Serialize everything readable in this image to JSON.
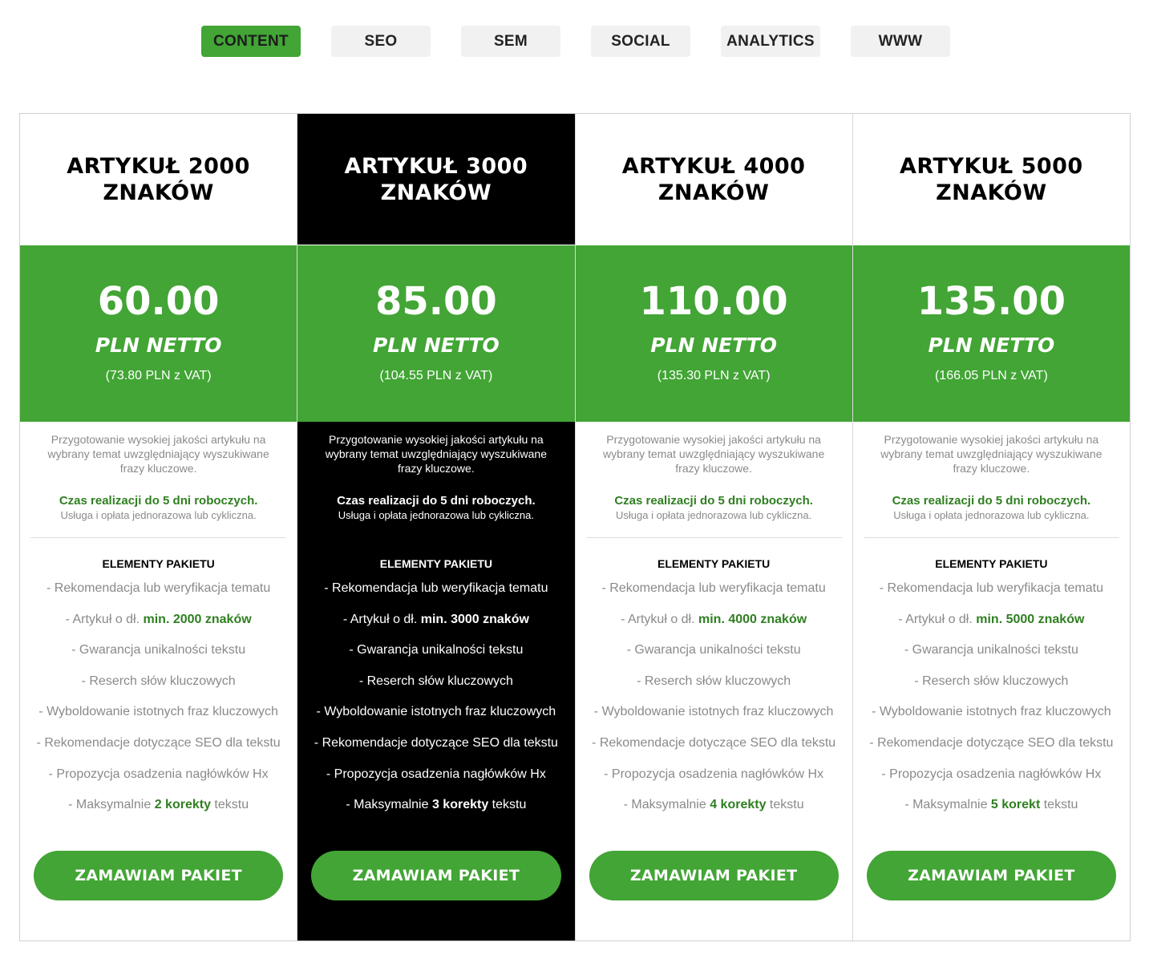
{
  "tabs": [
    {
      "label": "CONTENT",
      "active": true
    },
    {
      "label": "SEO",
      "active": false
    },
    {
      "label": "SEM",
      "active": false
    },
    {
      "label": "SOCIAL",
      "active": false
    },
    {
      "label": "ANALYTICS",
      "active": false
    },
    {
      "label": "WWW",
      "active": false
    }
  ],
  "colors": {
    "accent": "#42a535",
    "accent_text": "#2f7f21",
    "featured_bg": "#000000"
  },
  "shared": {
    "description": "Przygotowanie wysokiej jakości artykułu na wybrany temat uwzględniający wyszukiwane frazy kluczowe.",
    "time": "Czas realizacji do 5 dni roboczych.",
    "note": "Usługa i opłata jednorazowa lub cykliczna.",
    "elements_title": "ELEMENTY PAKIETU",
    "unit": "PLN NETTO",
    "button_label": "ZAMAWIAM PAKIET",
    "features": {
      "f1": "- Rekomendacja lub weryfikacja tematu",
      "f2_prefix": "- Artykuł o dł. ",
      "f3": "- Gwarancja unikalności tekstu",
      "f4": "- Reserch słów kluczowych",
      "f5": "- Wyboldowanie istotnych fraz kluczowych",
      "f6": "- Rekomendacje dotyczące SEO dla tekstu",
      "f7": "- Propozycja osadzenia nagłówków Hx",
      "f8_prefix": "- Maksymalnie ",
      "f8_suffix": " tekstu"
    }
  },
  "plans": [
    {
      "title_line1": "ARTYKUŁ 2000",
      "title_line2": "ZNAKÓW",
      "price": "60.00",
      "vat": "(73.80 PLN z VAT)",
      "length": "min. 2000 znaków",
      "corrections": "2 korekty",
      "featured": false
    },
    {
      "title_line1": "ARTYKUŁ 3000",
      "title_line2": "ZNAKÓW",
      "price": "85.00",
      "vat": "(104.55 PLN z VAT)",
      "length": "min. 3000 znaków",
      "corrections": "3 korekty",
      "featured": true
    },
    {
      "title_line1": "ARTYKUŁ 4000",
      "title_line2": "ZNAKÓW",
      "price": "110.00",
      "vat": "(135.30 PLN z VAT)",
      "length": "min. 4000 znaków",
      "corrections": "4 korekty",
      "featured": false
    },
    {
      "title_line1": "ARTYKUŁ 5000",
      "title_line2": "ZNAKÓW",
      "price": "135.00",
      "vat": "(166.05 PLN z VAT)",
      "length": "min. 5000 znaków",
      "corrections": "5 korekt",
      "featured": false
    }
  ]
}
